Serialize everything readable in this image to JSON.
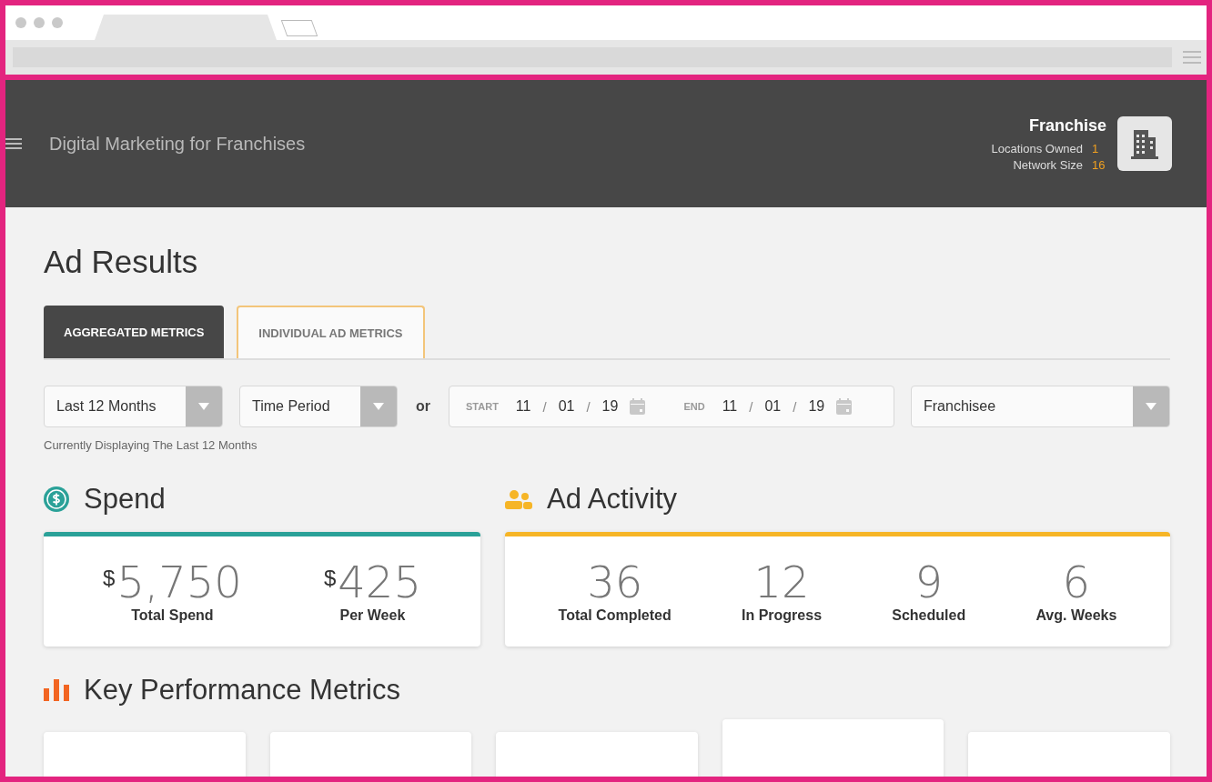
{
  "header": {
    "title": "Digital Marketing for Franchises",
    "profile": {
      "name": "Franchise",
      "stats": [
        {
          "label": "Locations Owned",
          "value": "1"
        },
        {
          "label": "Network Size",
          "value": "16"
        }
      ]
    }
  },
  "page_title": "Ad Results",
  "tabs": [
    {
      "label": "AGGREGATED METRICS",
      "selected": true
    },
    {
      "label": "INDIVIDUAL AD METRICS",
      "selected": false
    }
  ],
  "filters": {
    "range_select": {
      "value": "Last 12 Months"
    },
    "period_select": {
      "value": "Time Period"
    },
    "or_label": "or",
    "dates": [
      {
        "label": "START",
        "parts": [
          "11",
          "01",
          "19"
        ],
        "separators": [
          "/",
          "/"
        ]
      },
      {
        "label": "END",
        "parts": [
          "11",
          "01",
          "19"
        ],
        "separators": [
          "/",
          "/"
        ]
      }
    ],
    "franchisee_select": {
      "value": "Franchisee"
    },
    "hint": "Currently Displaying The Last 12 Months"
  },
  "spend": {
    "title": "Spend",
    "color": "#2aa198",
    "items": [
      {
        "currency": "$",
        "value": "5,750",
        "label": "Total Spend"
      },
      {
        "currency": "$",
        "value": "425",
        "label": "Per Week"
      }
    ]
  },
  "ad_activity": {
    "title": "Ad Activity",
    "color": "#f6b526",
    "items": [
      {
        "value": "36",
        "label": "Total Completed"
      },
      {
        "value": "12",
        "label": "In Progress"
      },
      {
        "value": "9",
        "label": "Scheduled"
      },
      {
        "value": "6",
        "label": "Avg. Weeks"
      }
    ]
  },
  "kpi": {
    "title": "Key Performance Metrics",
    "cards": [
      {
        "raised": false
      },
      {
        "raised": false
      },
      {
        "raised": false
      },
      {
        "raised": true
      },
      {
        "raised": false
      }
    ]
  }
}
